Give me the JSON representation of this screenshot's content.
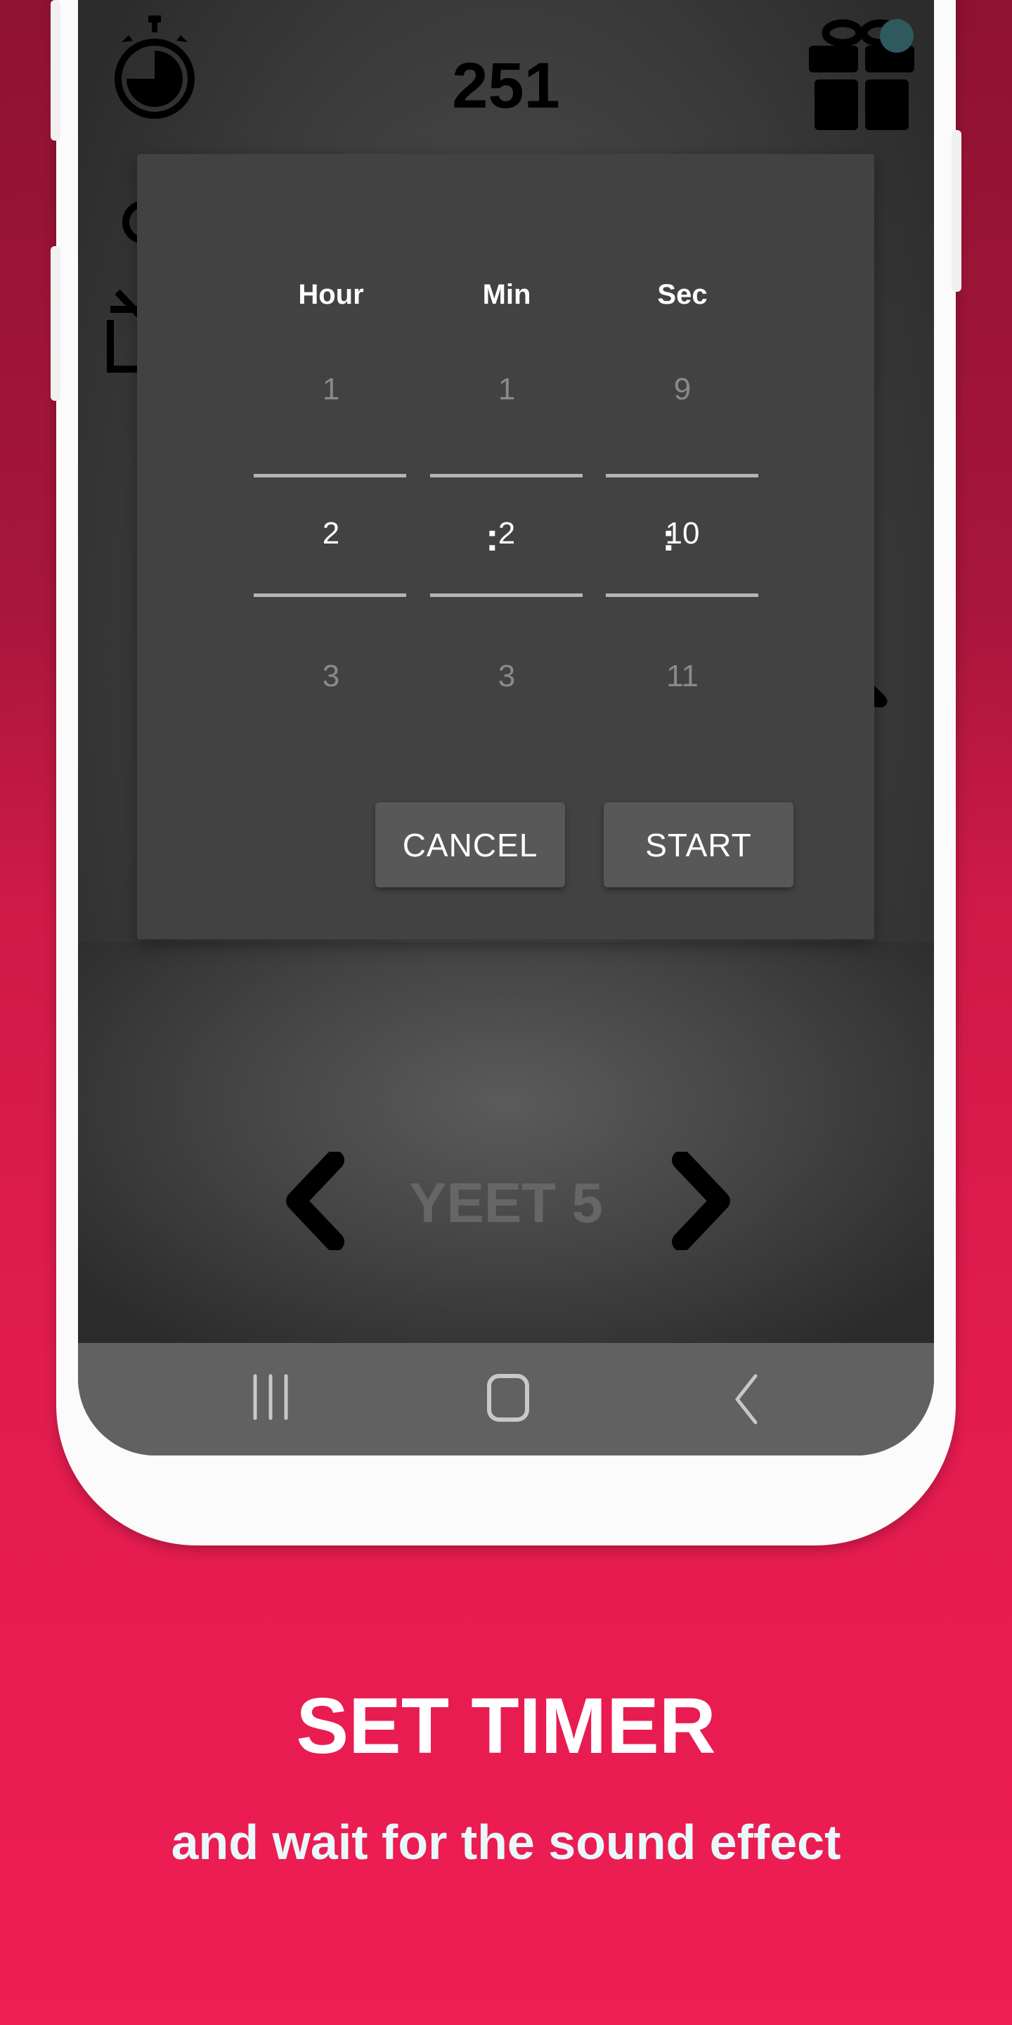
{
  "screen": {
    "counter": "251",
    "background_fragments_visible": true,
    "carousel_label": "YEET 5",
    "notification_dot_color": "#2e5a5e"
  },
  "timer_dialog": {
    "columns": [
      {
        "header": "Hour",
        "above": "1",
        "selected": "2",
        "below": "3"
      },
      {
        "header": "Min",
        "above": "1",
        "selected": "2",
        "below": "3"
      },
      {
        "header": "Sec",
        "above": "9",
        "selected": "10",
        "below": "11"
      }
    ],
    "separator": ":",
    "cancel_label": "CANCEL",
    "start_label": "START"
  },
  "system_nav": {
    "recents": "recents-icon",
    "home": "home-icon",
    "back": "back-icon"
  },
  "promo": {
    "title": "SET TIMER",
    "subtitle": "and wait for the sound effect",
    "bg_top_color": "#8f1232",
    "bg_bottom_color": "#ee1d53"
  }
}
